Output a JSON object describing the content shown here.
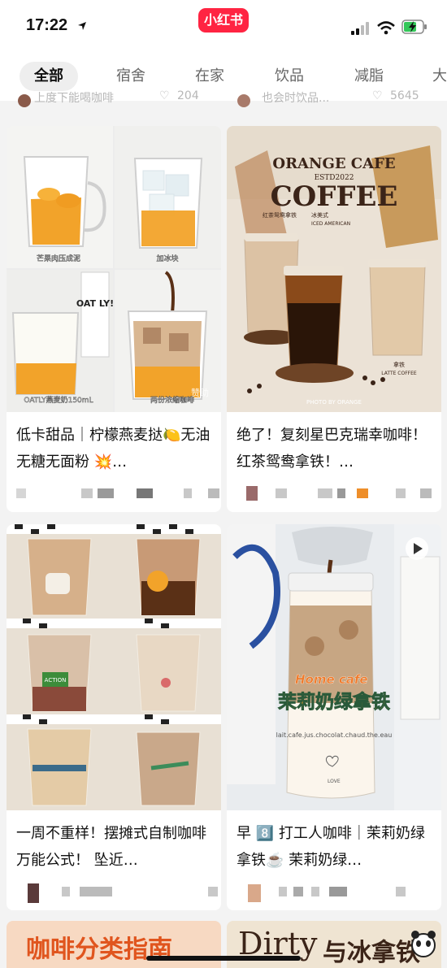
{
  "status_bar": {
    "time": "17:22",
    "brand": "小红书",
    "icons": [
      "location-arrow-icon",
      "cellular-signal-icon",
      "wifi-icon",
      "battery-charging-icon"
    ]
  },
  "tabs": [
    {
      "label": "全部",
      "active": true
    },
    {
      "label": "宿舍",
      "active": false
    },
    {
      "label": "在家",
      "active": false
    },
    {
      "label": "饮品",
      "active": false
    },
    {
      "label": "减脂",
      "active": false
    },
    {
      "label": "大",
      "active": false
    }
  ],
  "peek_row": {
    "left_text": "上度下能喝咖啡",
    "left_likes": "204",
    "right_text": "也会时饮品...",
    "right_likes": "5645"
  },
  "cards": [
    {
      "title": "低卡甜品｜柠檬燕麦挞🍋无油无糖无面粉 💥…",
      "image_captions": [
        "芒果肉压成泥",
        "加冰块",
        "OATLY燕麦奶150mL",
        "两份浓缩咖啡"
      ],
      "image_brand": "OAT LY!",
      "image_watermark": "赞助"
    },
    {
      "title": "绝了！复刻星巴克瑞幸咖啡！红茶鸳鸯拿铁！…",
      "image_header": "ORANGE CAFE",
      "image_subheader": "ESTD2022",
      "image_word": "COFFEE",
      "image_labels": [
        "红茶鸳鸯拿铁",
        "冰美式",
        "ICED AMERICAN",
        "拿铁",
        "LATTE COFFEE",
        "PHOTO BY ORANGE"
      ]
    },
    {
      "title": "一周不重样！摆摊式自制咖啡万能公式！ 坠近…",
      "image_sticker": "ACTION"
    },
    {
      "title": "早 8️⃣ 打工人咖啡｜茉莉奶绿拿铁☕️ 茉莉奶绿…",
      "image_tag": "Home cafe",
      "image_title": "茉莉奶绿拿铁",
      "image_bottle_text": "lait.cafe.jus.chocolat.chaud.the.eau",
      "image_bottle_love": "LOVE"
    }
  ],
  "peek_bottom": {
    "left": "咖啡分类指南",
    "right_latin": "Dirty",
    "right_cjk": "与冰拿铁"
  },
  "colors": {
    "brand": "#ff2442",
    "coffee_dark": "#5a3016",
    "latte": "#d9b792",
    "mango": "#f2a32a"
  }
}
